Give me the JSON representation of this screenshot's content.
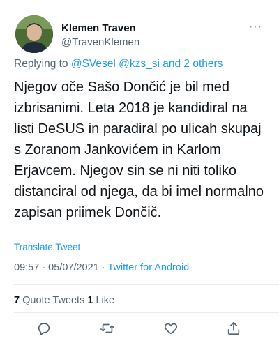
{
  "author": {
    "display_name": "Klemen Traven",
    "handle": "@TravenKlemen",
    "more_label": "···"
  },
  "replying": {
    "prefix": "Replying to ",
    "links": "@SVesel @kzs_si and 2 others"
  },
  "tweet": {
    "text": "Njegov oče Sašo Dončić je bil med izbrisanimi. Leta 2018 je kandidiral na listi DeSUS in paradiral po ulicah skupaj s Zoranom Jankovićem in Karlom Erjavcem. Njegov sin se ni niti toliko distanciral od njega, da bi imel normalno zapisan priimek Dončič.",
    "translate_label": "Translate Tweet",
    "time": "09:57 · 05/07/2021 · ",
    "source": "Twitter for Android"
  },
  "stats": {
    "quote_count": "7",
    "quote_label": " Quote Tweets  ",
    "like_count": "1",
    "like_label": " Like"
  },
  "actions": [
    "reply-icon",
    "retweet-icon",
    "like-icon",
    "share-icon"
  ],
  "colors": {
    "link": "#1d9bf0",
    "secondary": "#536471",
    "text": "#0f1419"
  }
}
